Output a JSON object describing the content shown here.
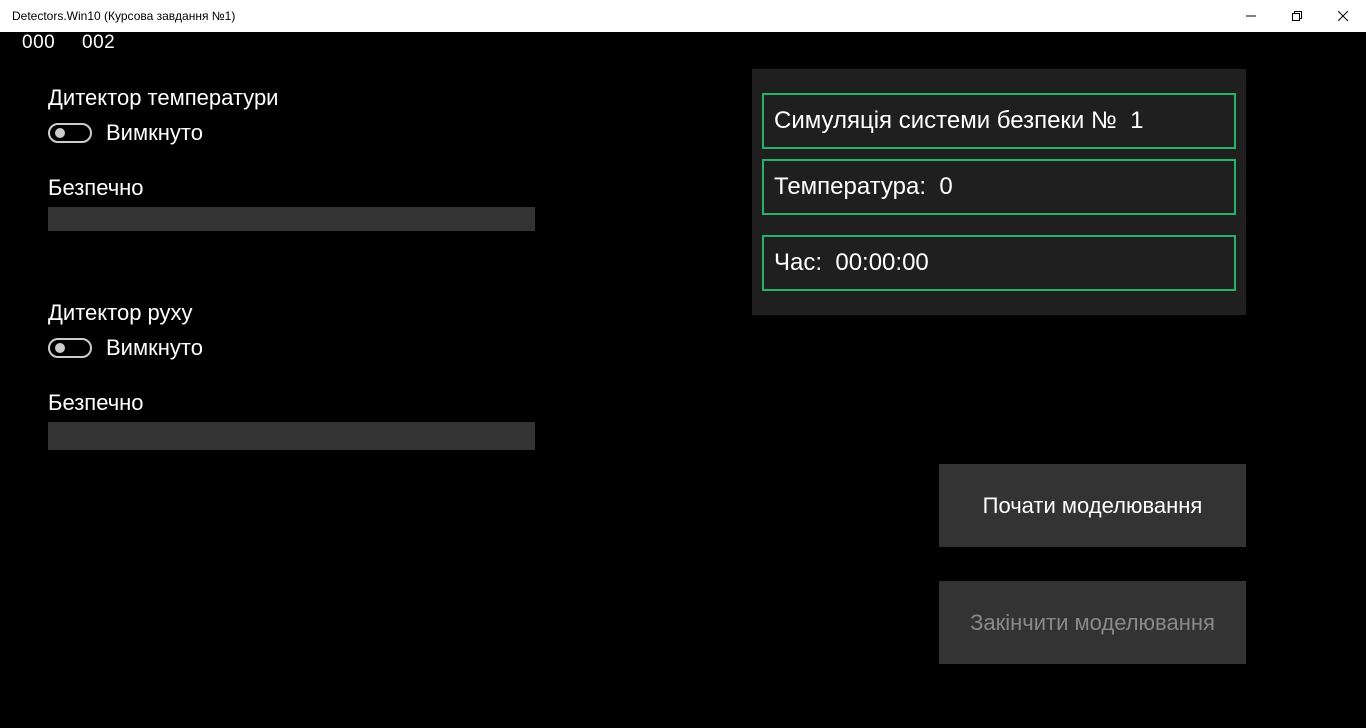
{
  "window": {
    "title": "Detectors.Win10 (Курсова завдання №1)"
  },
  "counters": [
    "000",
    "002"
  ],
  "temperature_detector": {
    "title": "Дитектор температури",
    "toggle_label": "Вимкнуто",
    "toggle_on": false,
    "status": "Безпечно",
    "progress": 0
  },
  "motion_detector": {
    "title": "Дитектор руху",
    "toggle_label": "Вимкнуто",
    "toggle_on": false,
    "status": "Безпечно",
    "progress": 0
  },
  "info_panel": {
    "simulation": "Симуляція системи безпеки №  1",
    "temperature": "Температура:  0",
    "time": "Час:  00:00:00"
  },
  "buttons": {
    "start": "Почати моделювання",
    "stop": "Закінчити моделювання"
  },
  "colors": {
    "background": "#000000",
    "accent_border": "#27b26b",
    "panel": "#1f1f1f",
    "button": "#333333",
    "disabled_text": "#8a8a8a"
  },
  "icons": {
    "minimize": "minimize-icon",
    "maximize": "restore-icon",
    "close": "close-icon"
  }
}
